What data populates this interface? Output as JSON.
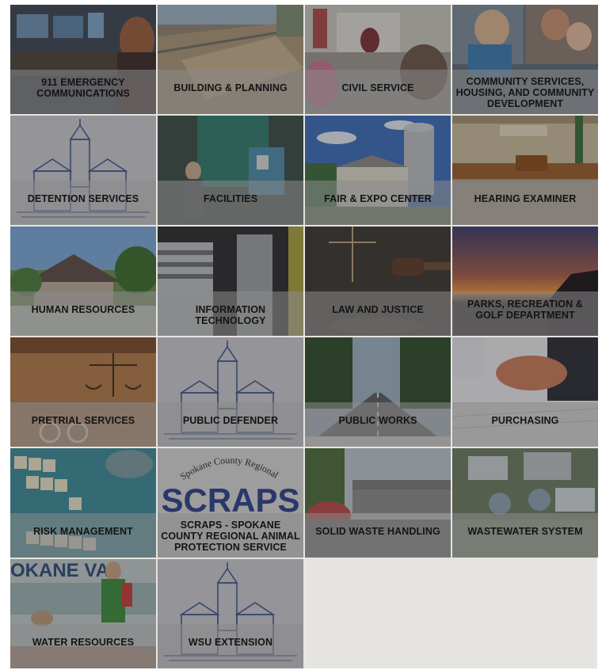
{
  "departments": [
    {
      "label": "911 Emergency Communications",
      "icon": "dispatch-center-photo"
    },
    {
      "label": "Building & Planning",
      "icon": "construction-site-photo"
    },
    {
      "label": "Civil Service",
      "icon": "meeting-room-photo"
    },
    {
      "label": "Community Services, Housing, and Community Development",
      "icon": "families-photo"
    },
    {
      "label": "Detention Services",
      "icon": "courthouse-emblem"
    },
    {
      "label": "Facilities",
      "icon": "boiler-room-photo"
    },
    {
      "label": "Fair & Expo Center",
      "icon": "fairgrounds-photo"
    },
    {
      "label": "Hearing Examiner",
      "icon": "hearing-room-photo"
    },
    {
      "label": "Human Resources",
      "icon": "house-photo"
    },
    {
      "label": "Information Technology",
      "icon": "server-rack-photo"
    },
    {
      "label": "Law and Justice",
      "icon": "gavel-photo"
    },
    {
      "label": "Parks, Recreation & Golf Department",
      "icon": "sunset-photo"
    },
    {
      "label": "Pretrial Services",
      "icon": "scales-handcuffs-photo"
    },
    {
      "label": "Public Defender",
      "icon": "courthouse-emblem"
    },
    {
      "label": "Public Works",
      "icon": "road-photo"
    },
    {
      "label": "Purchasing",
      "icon": "handshake-photo"
    },
    {
      "label": "Risk Management",
      "icon": "scrabble-tiles-photo"
    },
    {
      "label": "SCRAPS - Spokane County Regional Animal Protection Service",
      "icon": "scraps-logo",
      "logo_text": "SCRAPS",
      "logo_arc_text": "Spokane County Regional"
    },
    {
      "label": "Solid Waste Handling",
      "icon": "transfer-station-photo"
    },
    {
      "label": "Wastewater System",
      "icon": "aerial-plant-photo"
    },
    {
      "label": "Water Resources",
      "icon": "kids-exhibit-photo",
      "sign_text": "OKANE VA"
    },
    {
      "label": "WSU Extension",
      "icon": "courthouse-emblem"
    }
  ],
  "colors": {
    "page_background": "#e6e4e1",
    "label_band": "#8a8a8a",
    "label_text": "#141414",
    "emblem_blue": "#3a4f8a"
  }
}
